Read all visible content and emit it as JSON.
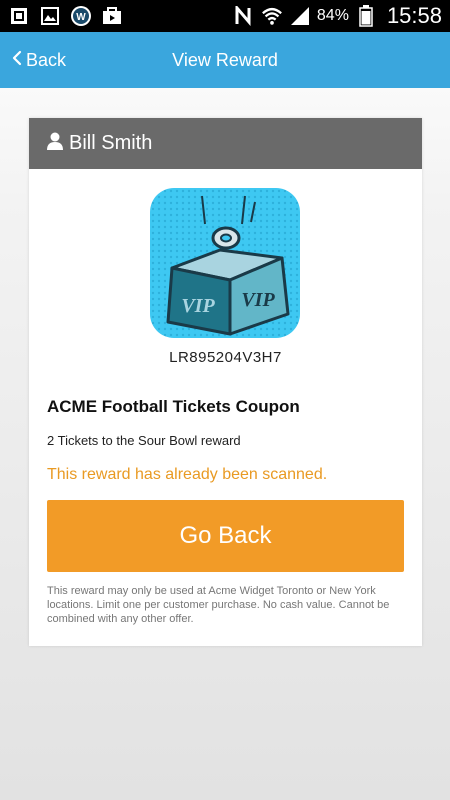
{
  "status_bar": {
    "battery_percent": "84%",
    "time": "15:58",
    "left_icons": [
      "gallery-icon",
      "image-icon",
      "app-w-icon",
      "briefcase-icon"
    ],
    "right_icons": [
      "nfc-icon",
      "wifi-icon",
      "signal-icon",
      "battery-icon"
    ]
  },
  "navbar": {
    "back_label": "Back",
    "title": "View Reward",
    "color": "#3aa6dd"
  },
  "card": {
    "user_name": "Bill Smith",
    "image_labels": [
      "VIP",
      "VIP"
    ],
    "reward_code": "LR895204V3H7",
    "reward_title": "ACME Football Tickets Coupon",
    "reward_description": "2 Tickets to the Sour Bowl reward",
    "status_message": "This reward has already been scanned.",
    "button_label": "Go Back",
    "fine_print": "This reward may only be used at Acme Widget Toronto or New York locations. Limit one per customer purchase. No cash value. Cannot be combined with any other offer."
  },
  "colors": {
    "accent": "#f29b27",
    "status_text": "#e99a23",
    "header_bg": "#6a6a6a",
    "image_bg": "#3ec8f2"
  }
}
